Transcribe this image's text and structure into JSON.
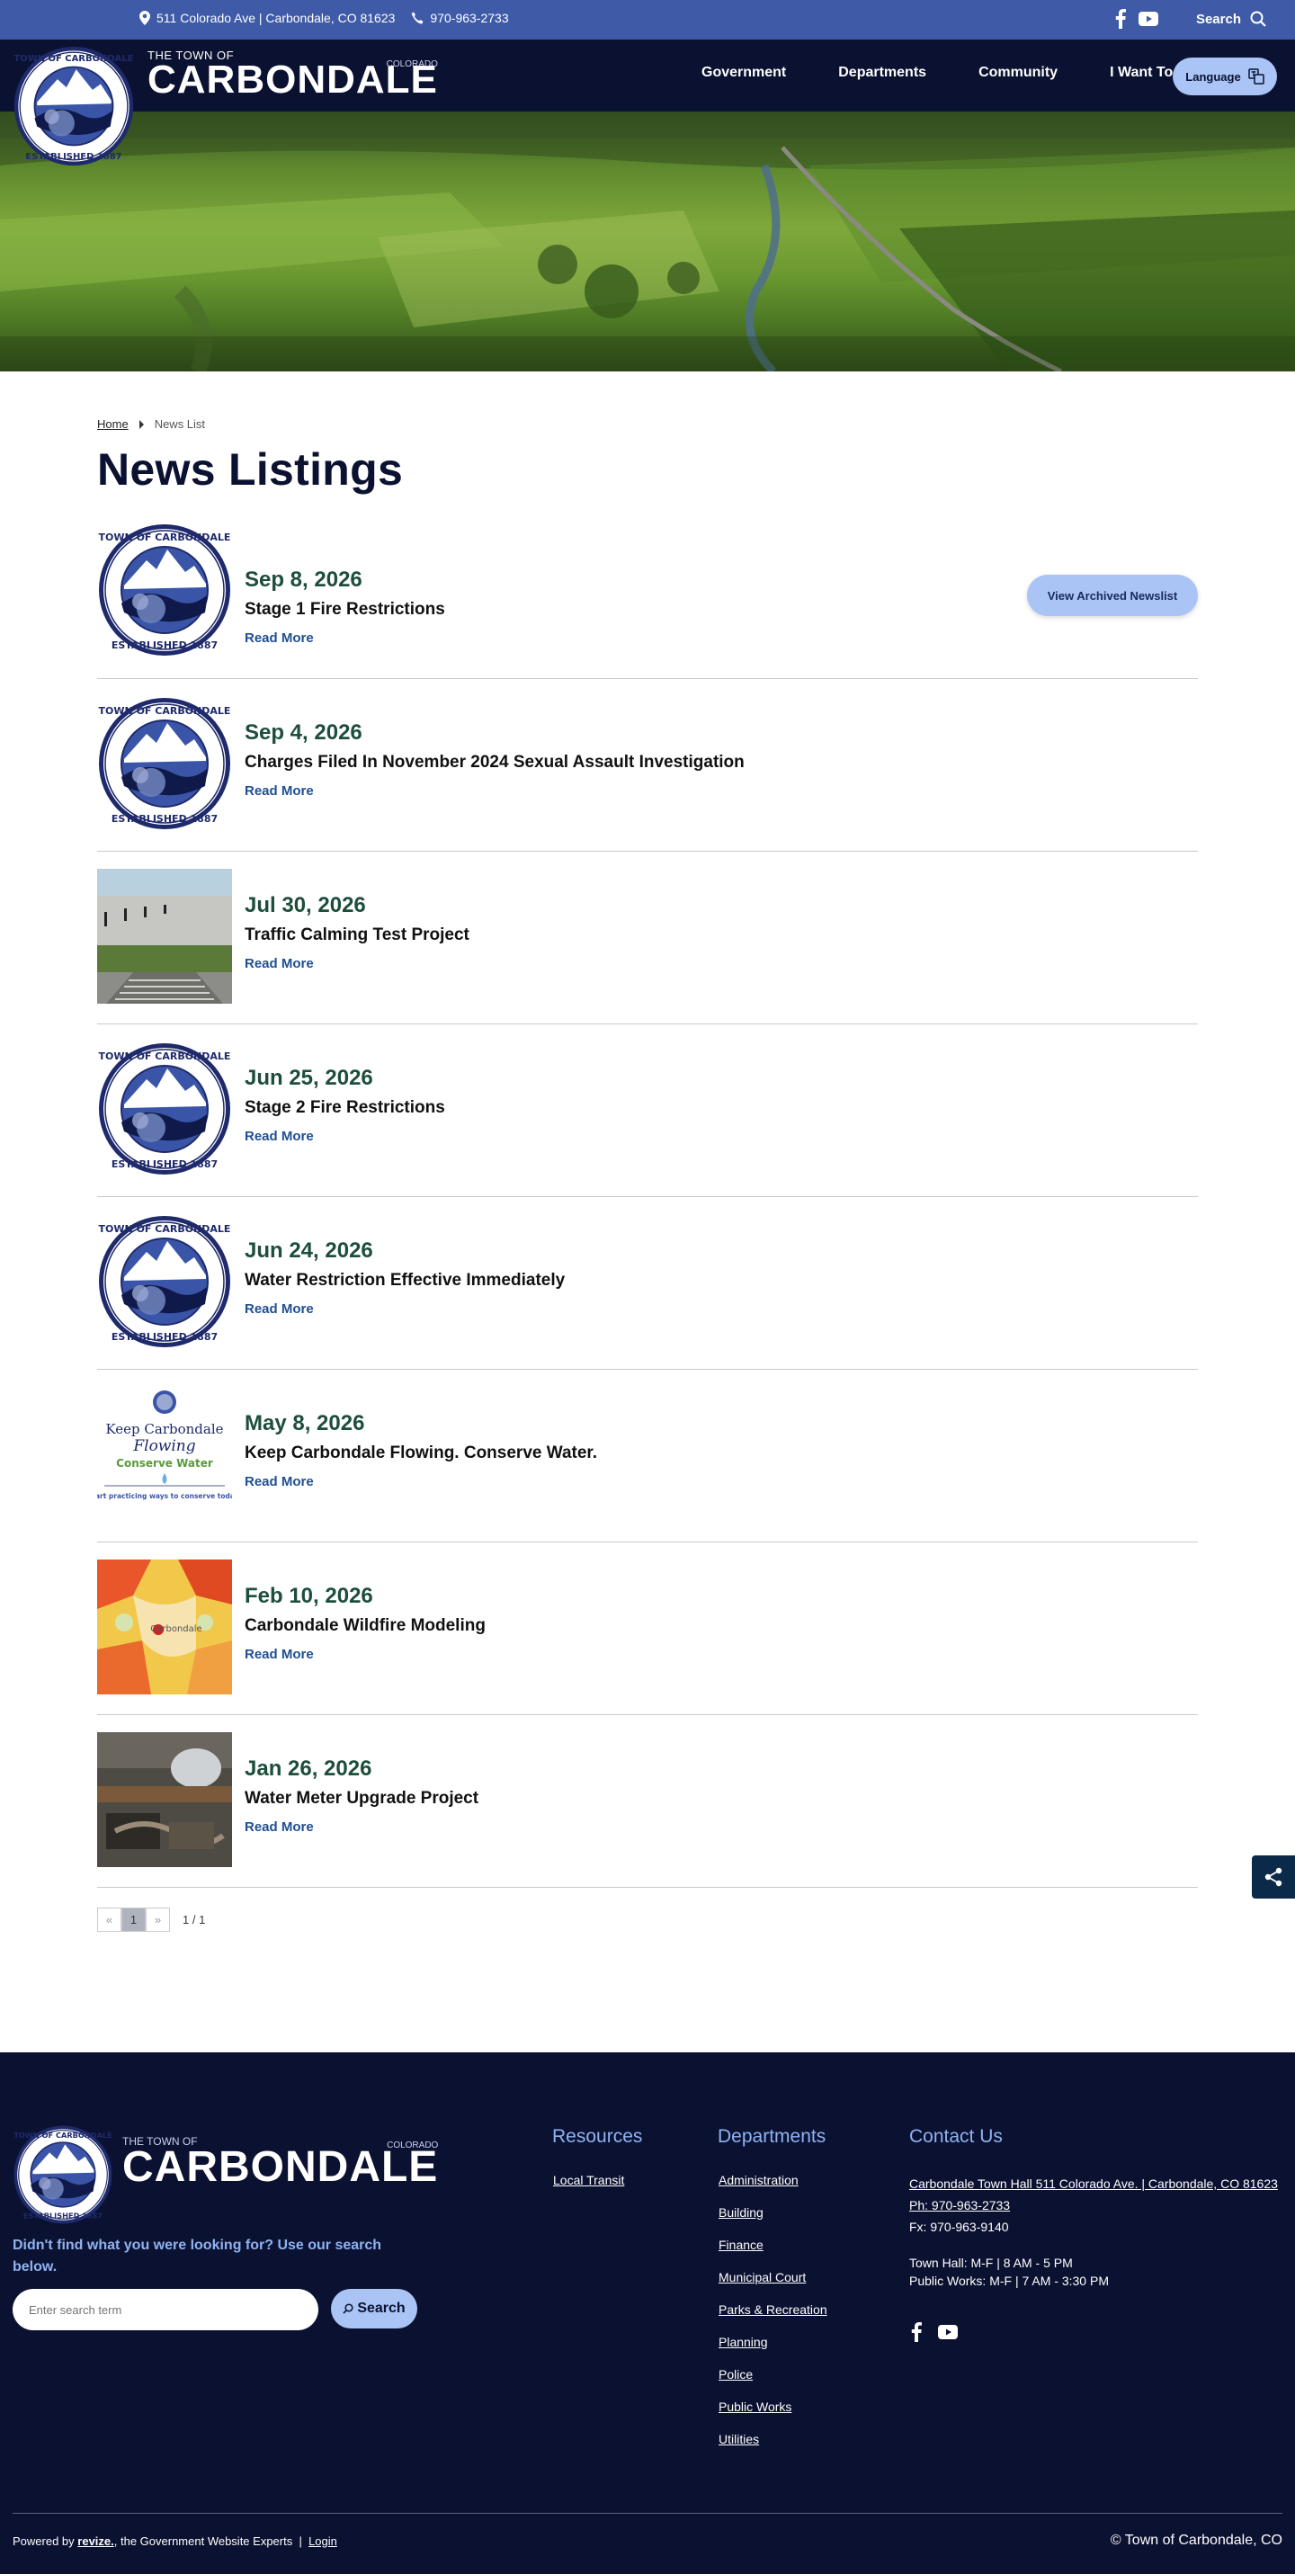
{
  "topbar": {
    "address": "511 Colorado Ave | Carbondale, CO 81623",
    "phone": "970-963-2733",
    "search_label": "Search"
  },
  "brand": {
    "small": "THE TOWN OF",
    "big": "CARBONDALE",
    "state": "COLORADO",
    "seal_top": "TOWN OF CARBONDALE",
    "seal_bottom": "ESTABLISHED 1887"
  },
  "nav": {
    "items": [
      "Government",
      "Departments",
      "Community",
      "I Want To"
    ],
    "language_label": "Language"
  },
  "breadcrumb": {
    "home": "Home",
    "current": "News List"
  },
  "page": {
    "title": "News Listings",
    "archived_button": "View Archived Newslist"
  },
  "news": [
    {
      "date": "Sep 8, 2026",
      "title": "Stage 1 Fire Restrictions",
      "link": "Read More",
      "thumb": "seal"
    },
    {
      "date": "Sep 4, 2026",
      "title": "Charges Filed In November 2024 Sexual Assault Investigation",
      "link": "Read More",
      "thumb": "seal"
    },
    {
      "date": "Jul 30, 2026",
      "title": "Traffic Calming Test Project",
      "link": "Read More",
      "thumb": "road-photo"
    },
    {
      "date": "Jun 25, 2026",
      "title": "Stage 2 Fire Restrictions",
      "link": "Read More",
      "thumb": "seal"
    },
    {
      "date": "Jun 24, 2026",
      "title": "Water Restriction Effective Immediately",
      "link": "Read More",
      "thumb": "seal"
    },
    {
      "date": "May 8, 2026",
      "title": "Keep Carbondale Flowing. Conserve Water.",
      "link": "Read More",
      "thumb": "water-poster"
    },
    {
      "date": "Feb 10, 2026",
      "title": "Carbondale Wildfire Modeling",
      "link": "Read More",
      "thumb": "fire-map"
    },
    {
      "date": "Jan 26, 2026",
      "title": "Water Meter Upgrade Project",
      "link": "Read More",
      "thumb": "meter-photo"
    }
  ],
  "poster": {
    "line1": "Keep Carbondale",
    "line2": "Flowing",
    "line3": "Conserve Water",
    "line4": "Start practicing ways to conserve today!"
  },
  "map_label": "Carbondale",
  "pager": {
    "prev": "«",
    "current": "1",
    "next": "»",
    "count": "1 / 1"
  },
  "footer": {
    "help_text": "Didn't find what you were looking for? Use our search below.",
    "search_placeholder": "Enter search term",
    "search_button": "Search",
    "resources_heading": "Resources",
    "resources": [
      "Local Transit"
    ],
    "departments_heading": "Departments",
    "departments": [
      "Administration",
      "Building",
      "Finance",
      "Municipal Court",
      "Parks & Recreation",
      "Planning",
      "Police",
      "Public Works",
      "Utilities"
    ],
    "contact_heading": "Contact Us",
    "contact_address": "Carbondale Town Hall 511 Colorado Ave. | Carbondale, CO 81623",
    "contact_phone": "Ph: 970-963-2733",
    "contact_fax": "Fx: 970-963-9140",
    "hours_town_hall": "Town Hall: M-F | 8 AM - 5 PM",
    "hours_public_works": "Public Works: M-F | 7 AM - 3:30 PM",
    "powered_prefix": "Powered by",
    "powered_brand": "revize.",
    "powered_suffix": ", the Government Website Experts",
    "login": "Login",
    "copyright": "© Town of Carbondale, CO"
  },
  "colors": {
    "topbar": "#3f5aa6",
    "navy": "#0b1130",
    "accent_button": "#a9c4f5",
    "date_green": "#1d4e3b",
    "link_blue": "#1f4f91"
  },
  "icons": {
    "topbar": [
      "map-pin-icon",
      "phone-icon",
      "facebook-icon",
      "youtube-icon",
      "search-icon"
    ],
    "nav": [
      "translate-icon"
    ],
    "footer": [
      "search-icon",
      "facebook-icon",
      "youtube-icon"
    ],
    "floating": [
      "share-icon"
    ]
  }
}
